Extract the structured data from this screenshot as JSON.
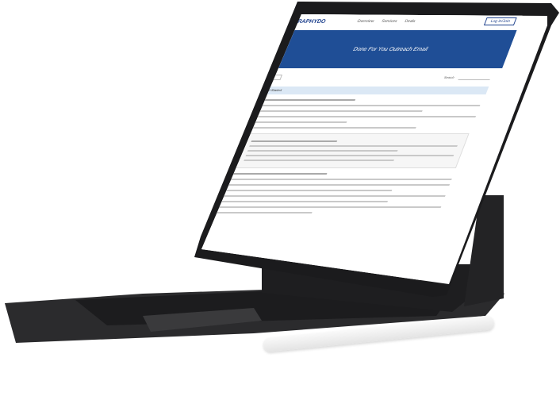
{
  "site": {
    "logo_text": "GRAPHYDO",
    "nav": [
      "Overview",
      "Services",
      "Deals"
    ],
    "login_label": "Log in/Join"
  },
  "banner": {
    "title": "Done For You Outreach Email"
  },
  "toolbar": {
    "search_label": "Search"
  },
  "category": {
    "label": "Get Started"
  }
}
